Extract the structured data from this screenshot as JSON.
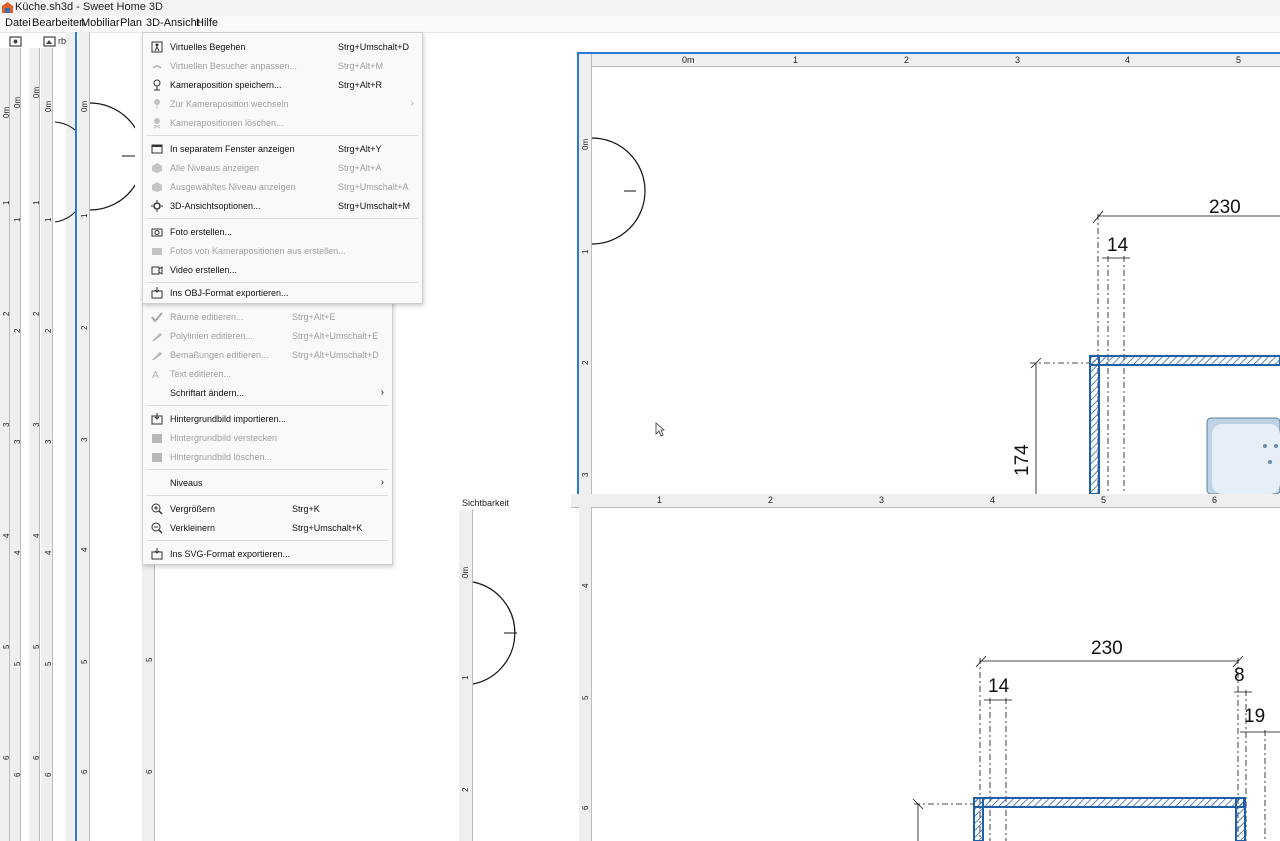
{
  "window": {
    "title": "Küche.sh3d - Sweet Home 3D"
  },
  "menubar": [
    "Datei",
    "Bearbeiten",
    "Mobiliar",
    "Plan",
    "3D-Ansicht",
    "Hilfe"
  ],
  "toolbar_fragment": {
    "text": "rbeit"
  },
  "menu_3d": {
    "items": [
      {
        "label": "Virtuelles Begehen",
        "shortcut": "Strg+Umschalt+D",
        "enabled": true,
        "icon": "walk-icon"
      },
      {
        "label": "Virtuellen Besucher anpassen...",
        "shortcut": "Strg+Alt+M",
        "enabled": false,
        "icon": "visitor-icon"
      },
      {
        "label": "Kameraposition speichern...",
        "shortcut": "Strg+Alt+R",
        "enabled": true,
        "icon": "camera-save-icon"
      },
      {
        "label": "Zur Kameraposition wechseln",
        "shortcut": "",
        "enabled": false,
        "icon": "camera-go-icon",
        "submenu": true
      },
      {
        "label": "Kamerapositionen löschen...",
        "shortcut": "",
        "enabled": false,
        "icon": "camera-delete-icon"
      },
      {
        "label": "In separatem Fenster anzeigen",
        "shortcut": "Strg+Alt+Y",
        "enabled": true,
        "icon": "window-icon"
      },
      {
        "label": "Alle Niveaus anzeigen",
        "shortcut": "Strg+Alt+A",
        "enabled": false,
        "icon": "levels-icon"
      },
      {
        "label": "Ausgewähltes Niveau anzeigen",
        "shortcut": "Strg+Umschalt+A",
        "enabled": false,
        "icon": "level-icon"
      },
      {
        "label": "3D-Ansichtsoptionen...",
        "shortcut": "Strg+Umschalt+M",
        "enabled": true,
        "icon": "options-icon"
      },
      {
        "label": "Foto erstellen...",
        "shortcut": "",
        "enabled": true,
        "icon": "photo-icon"
      },
      {
        "label": "Fotos von Kamerapositionen aus erstellen...",
        "shortcut": "",
        "enabled": false,
        "icon": "photos-icon"
      },
      {
        "label": "Video erstellen...",
        "shortcut": "",
        "enabled": true,
        "icon": "video-icon"
      },
      {
        "label": "Ins OBJ-Format exportieren...",
        "shortcut": "",
        "enabled": true,
        "icon": "export-obj-icon"
      }
    ]
  },
  "menu_plan": {
    "items": [
      {
        "label": "Räume editieren...",
        "shortcut": "Strg+Alt+E",
        "enabled": false,
        "icon": "room-edit-icon"
      },
      {
        "label": "Polylinien editieren...",
        "shortcut": "Strg+Alt+Umschalt+E",
        "enabled": false,
        "icon": "polyline-edit-icon"
      },
      {
        "label": "Bemaßungen editieren...",
        "shortcut": "Strg+Alt+Umschalt+D",
        "enabled": false,
        "icon": "dimension-edit-icon"
      },
      {
        "label": "Text editieren...",
        "shortcut": "",
        "enabled": false,
        "icon": "text-edit-icon"
      },
      {
        "label": "Schriftart ändern...",
        "shortcut": "",
        "enabled": true,
        "icon": "",
        "submenu": true
      },
      {
        "label": "Hintergrundbild importieren...",
        "shortcut": "",
        "enabled": true,
        "icon": "bg-import-icon"
      },
      {
        "label": "Hintergrundbild verstecken",
        "shortcut": "",
        "enabled": false,
        "icon": "bg-hide-icon"
      },
      {
        "label": "Hintergrundbild löschen...",
        "shortcut": "",
        "enabled": false,
        "icon": "bg-delete-icon"
      },
      {
        "label": "Niveaus",
        "shortcut": "",
        "enabled": true,
        "icon": "",
        "submenu": true
      },
      {
        "label": "Vergrößern",
        "shortcut": "Strg+K",
        "enabled": true,
        "icon": "zoom-in-icon"
      },
      {
        "label": "Verkleinern",
        "shortcut": "Strg+Umschalt+K",
        "enabled": true,
        "icon": "zoom-out-icon"
      },
      {
        "label": "Ins SVG-Format exportieren...",
        "shortcut": "",
        "enabled": true,
        "icon": "export-svg-icon"
      }
    ]
  },
  "panel": {
    "label": "Sichtbarkeit"
  },
  "plan_top": {
    "h_ticks": [
      "0m",
      "1",
      "2",
      "3",
      "4",
      "5"
    ],
    "v_ticks": [
      "0m",
      "1",
      "2",
      "3"
    ],
    "dims": [
      "230",
      "14",
      "174"
    ]
  },
  "plan_bottom": {
    "h_ticks": [
      "1",
      "2",
      "3",
      "4",
      "5",
      "6"
    ],
    "v_ticks": [
      "4",
      "5",
      "6"
    ],
    "dims": [
      "230",
      "14",
      "8",
      "19"
    ]
  },
  "left_rulers": {
    "ticks": [
      "0m",
      "1",
      "2",
      "3",
      "4",
      "5",
      "6"
    ]
  },
  "small_plan": {
    "v_ticks": [
      "0m",
      "1",
      "2"
    ]
  },
  "colors": {
    "selection": "#2b7bd6",
    "wall": "#1f5fa8",
    "ruler_bg": "#efefef"
  }
}
